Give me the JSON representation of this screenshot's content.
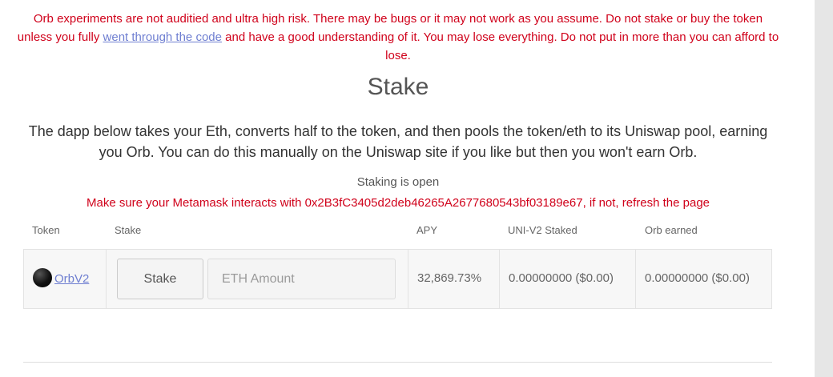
{
  "warning": {
    "text_before": "Orb experiments are not auditied and ultra high risk. There may be bugs or it may not work as you assume. Do not stake or buy the token unless you fully ",
    "link_text": "went through the code",
    "text_after": " and have a good understanding of it. You may lose everything. Do not put in more than you can afford to lose."
  },
  "title": "Stake",
  "description": "The dapp below takes your Eth, converts half to the token, and then pools the token/eth to its Uniswap pool, earning you Orb. You can do this manually on the Uniswap site if you like but then you won't earn Orb.",
  "status": "Staking is open",
  "metamask_notice": "Make sure your Metamask interacts with 0x2B3fC3405d2deb46265A2677680543bf03189e67, if not, refresh the page",
  "table": {
    "headers": {
      "token": "Token",
      "stake": "Stake",
      "apy": "APY",
      "staked": "UNI-V2 Staked",
      "earned": "Orb earned"
    },
    "rows": [
      {
        "token": "OrbV2",
        "stake_button": "Stake",
        "eth_placeholder": "ETH Amount",
        "apy": "32,869.73%",
        "staked": "0.00000000 ($0.00)",
        "earned": "0.00000000 ($0.00)"
      }
    ]
  },
  "icons": {
    "token_icon": "orb-token-icon"
  }
}
